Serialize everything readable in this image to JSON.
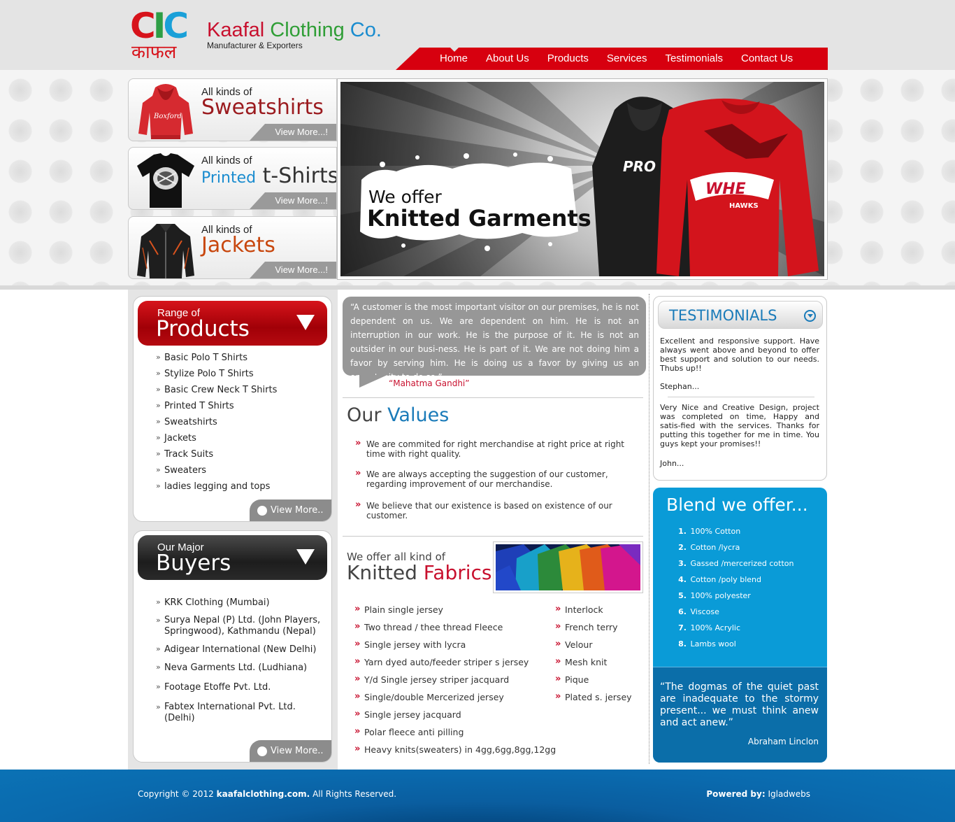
{
  "logo": {
    "mark": "CIC",
    "hindi": "काफल"
  },
  "brand": {
    "word1": "Kaafal",
    "word2": "Clothing",
    "word3": "Co.",
    "tagline": "Manufacturer & Exporters"
  },
  "nav": {
    "items": [
      "Home",
      "About Us",
      "Products",
      "Services",
      "Testimonials",
      "Contact Us"
    ]
  },
  "categories": [
    {
      "small": "All kinds of",
      "big_a": "Sweatshirts",
      "big_b": "",
      "color_a": "#9b1b1f",
      "color_b": "#333333",
      "more": "View More...!"
    },
    {
      "small": "All kinds of",
      "big_a": "Printed",
      "big_b": "t-Shirts",
      "color_a": "#1a8ccf",
      "color_b": "#333333",
      "more": "View More...!"
    },
    {
      "small": "All kinds of",
      "big_a": "Jackets",
      "big_b": "",
      "color_a": "#c8470e",
      "color_b": "#333333",
      "more": "View More...!"
    }
  ],
  "hero": {
    "line1": "We offer",
    "line2": "Knitted Garments",
    "front_print": "WHE",
    "front_sub": "HAWKS",
    "back_print": "PRO"
  },
  "products_panel": {
    "small": "Range of",
    "big": "Products",
    "items": [
      "Basic Polo T Shirts",
      "Stylize Polo T Shirts",
      "Basic Crew Neck T Shirts",
      "Printed T Shirts",
      "Sweatshirts",
      "Jackets",
      "Track Suits",
      "Sweaters",
      "ladies legging and  tops"
    ],
    "more": "View More.."
  },
  "buyers_panel": {
    "small": "Our Major",
    "big": "Buyers",
    "items": [
      "KRK Clothing (Mumbai)",
      "Surya Nepal (P) Ltd. (John Players, Springwood), Kathmandu (Nepal)",
      "Adigear International (New Delhi)",
      "Neva Garments Ltd. (Ludhiana)",
      "Footage Etoffe Pvt. Ltd.",
      "Fabtex International Pvt. Ltd. (Delhi)"
    ],
    "more": "View More.."
  },
  "quote": {
    "text": "“A customer is the most important visitor on our premises, he is not dependent on us. We are dependent on him. He is not an interruption in our work. He is the purpose of it. He is not an outsider in our busi-ness. He is part of it. We are not doing him a favor by serving him. He is doing us a favor by giving us an opportunity to do so.”",
    "author": "“Mahatma Gandhi”"
  },
  "values": {
    "title_a": "Our",
    "title_b": "Values",
    "items": [
      "We are commited for right merchandise at right price at right time with right quality.",
      "We are always accepting the suggestion of our customer, regarding improvement of our merchandise.",
      "We believe that our existence is based on existence of our customer."
    ]
  },
  "fabrics": {
    "small": "We offer all kind of",
    "big_a": "Knitted",
    "big_b": "Fabrics",
    "left": [
      "Plain single jersey",
      "Two thread / thee thread Fleece",
      "Single jersey with lycra",
      "Yarn dyed auto/feeder striper s jersey",
      "Y/d Single jersey striper jacquard",
      "Single/double Mercerized jersey",
      "Single jersey jacquard",
      "Polar fleece anti pilling",
      "Heavy knits(sweaters) in 4gg,6gg,8gg,12gg"
    ],
    "right": [
      "Interlock",
      "French terry",
      "Velour",
      "Mesh knit",
      "Pique",
      "Plated s. jersey"
    ]
  },
  "testimonials": {
    "title": "TESTIMONIALS",
    "items": [
      {
        "text": "Excellent and responsive support. Have always went above and beyond to offer best support and solution to our needs. Thubs up!!",
        "name": "Stephan..."
      },
      {
        "text": "Very Nice and Creative Design, project was completed on time, Happy and satis-fied with the services. Thanks for putting this together for me in time. You guys kept your promises!!",
        "name": "John..."
      }
    ]
  },
  "blend": {
    "title": "Blend we offer...",
    "items": [
      "100% Cotton",
      "Cotton /lycra",
      "Gassed /mercerized cotton",
      "Cotton /poly blend",
      "100% polyester",
      "Viscose",
      "100% Acrylic",
      "Lambs wool"
    ],
    "quote": "“The dogmas of the quiet past are inadequate to the stormy present... we must think anew and act anew.”",
    "author": "Abraham Linclon"
  },
  "footer": {
    "copyright_a": "Copyright © 2012",
    "copyright_site": "kaafalclothing.com.",
    "copyright_b": "All Rights Reserved.",
    "powered_label": "Powered by:",
    "powered_by": "Igladwebs"
  },
  "colors": {
    "brand_red": "#d7000f",
    "brand_blue": "#1a7bb9",
    "blend_blue": "#0a9bd7"
  }
}
